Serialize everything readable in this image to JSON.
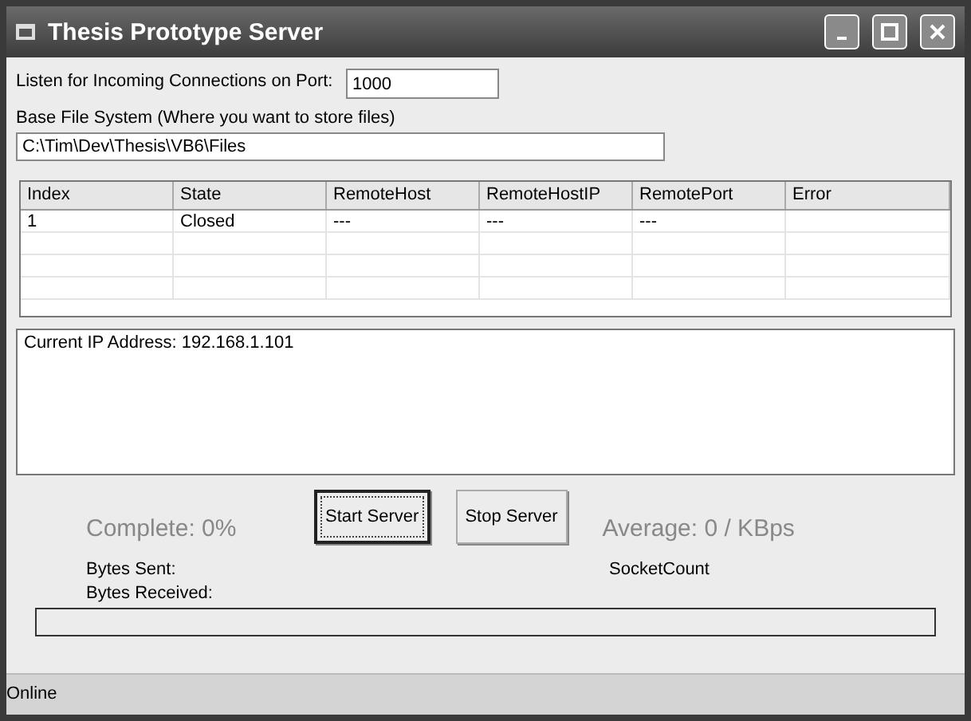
{
  "window": {
    "title": "Thesis Prototype Server"
  },
  "port": {
    "label": "Listen for Incoming Connections on Port:",
    "value": "1000"
  },
  "base_path": {
    "label": "Base File System (Where you want to store files)",
    "value": "C:\\Tim\\Dev\\Thesis\\VB6\\Files"
  },
  "table": {
    "columns": [
      "Index",
      "State",
      "RemoteHost",
      "RemoteHostIP",
      "RemotePort",
      "Error"
    ],
    "rows": [
      [
        "1",
        "Closed",
        "---",
        "---",
        "---",
        ""
      ]
    ]
  },
  "log": {
    "lines": [
      "Current IP Address: 192.168.1.101"
    ]
  },
  "complete": "Complete: 0%",
  "buttons": [
    {
      "label": "Start Server",
      "focused": true
    },
    {
      "label": "Stop Server",
      "focused": false
    }
  ],
  "average": "Average: 0 / KBps",
  "bytes_sent": "Bytes Sent:",
  "bytes_received": "Bytes Received:",
  "socket_count": "SocketCount",
  "progress": {
    "level": 0
  },
  "status_bar": "Online"
}
